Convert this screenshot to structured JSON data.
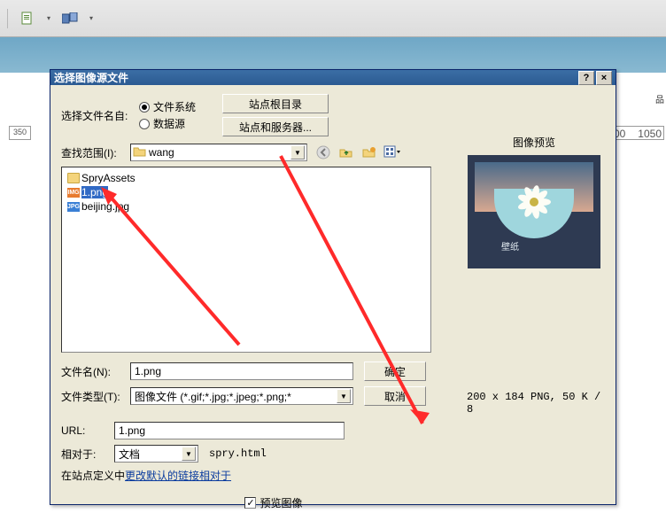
{
  "toolbar": {},
  "ruler": {
    "left": "350",
    "r1": "00",
    "r2": "1050"
  },
  "right_handle": "品",
  "dialog": {
    "title": "选择图像源文件",
    "help": "?",
    "close": "×",
    "select_from": "选择文件名自:",
    "radio_fs": "文件系统",
    "radio_ds": "数据源",
    "btn_site_root": "站点根目录",
    "btn_site_server": "站点和服务器...",
    "lookin_label": "查找范围(I):",
    "lookin_value": "wang",
    "files": {
      "folder": "SpryAssets",
      "f1": "1.png",
      "f2": "beijing.jpg"
    },
    "filename_label": "文件名(N):",
    "filename_value": "1.png",
    "filetype_label": "文件类型(T):",
    "filetype_value": "图像文件 (*.gif;*.jpg;*.jpeg;*.png;*",
    "ok": "确定",
    "cancel": "取消",
    "url_label": "URL:",
    "url_value": "1.png",
    "relative_label": "相对于:",
    "relative_value": "文档",
    "relative_file": "spry.html",
    "hint_prefix": "在站点定义中",
    "hint_link": "更改默认的链接相对于",
    "preview_title": "图像预览",
    "preview_tag": "壁纸",
    "preview_info": "200 x 184 PNG, 50 K / 8",
    "preview_cb": "预览图像"
  }
}
